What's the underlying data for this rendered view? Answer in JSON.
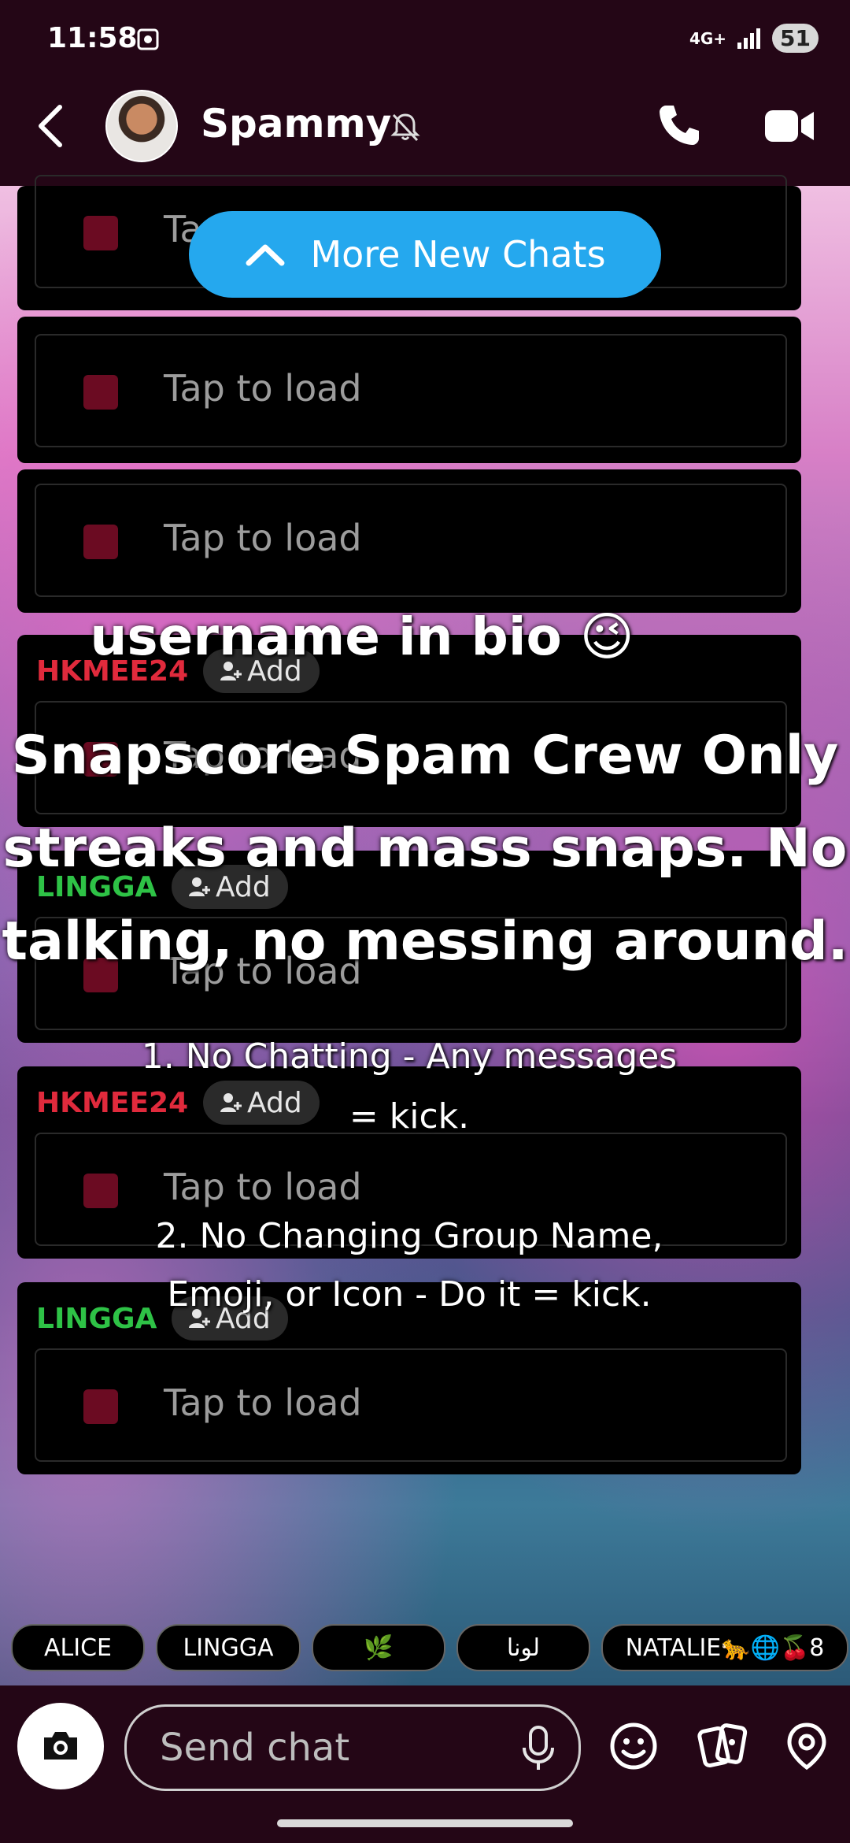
{
  "status_bar": {
    "time": "11:58",
    "network": "4G+",
    "battery": "51"
  },
  "header": {
    "title": "Spammy"
  },
  "banner": {
    "label": "More New Chats"
  },
  "messages": [
    {
      "placeholder": "Tap to load"
    },
    {
      "placeholder": "Tap to load"
    },
    {
      "placeholder": "Tap to load"
    },
    {
      "sender": "HKMEE24",
      "add_label": "Add",
      "placeholder": "Tap to load"
    },
    {
      "sender": "LINGGA",
      "add_label": "Add",
      "placeholder": "Tap to load"
    },
    {
      "sender": "HKMEE24",
      "add_label": "Add",
      "placeholder": "Tap to load"
    },
    {
      "sender": "LINGGA",
      "add_label": "Add",
      "placeholder": "Tap to load"
    }
  ],
  "overlay": {
    "line1": "username in bio 😉",
    "line2": "Snapscore Spam Crew Only",
    "line3": "streaks and mass snaps. No",
    "line4": "talking, no messing around.",
    "rule1a": "1. No Chatting - Any messages",
    "rule1b": "= kick.",
    "rule2a": "2. No Changing Group Name,",
    "rule2b": "Emoji, or Icon - Do it = kick."
  },
  "members": [
    "ALICE",
    "LINGGA",
    "🌿",
    "لونا",
    "NATALIE🐆🌐🍒8"
  ],
  "composer": {
    "placeholder": "Send chat"
  },
  "colors": {
    "sender_red": "#e02a3c",
    "sender_green": "#2ec246",
    "banner_blue": "#25a8ee",
    "bar_bg": "#240616"
  }
}
